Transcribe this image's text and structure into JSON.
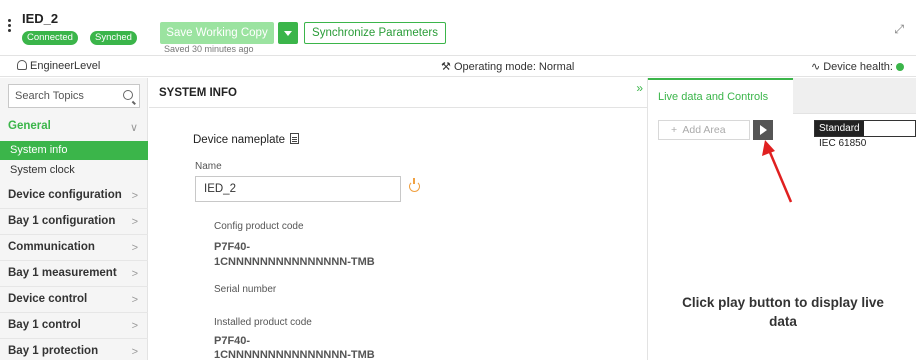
{
  "header": {
    "device_name": "IED_2",
    "badge_connected": "Connected",
    "badge_synched": "Synched",
    "save_label": "Save Working Copy",
    "sync_label": "Synchronize Parameters",
    "saved_text": "Saved 30 minutes ago",
    "accent_color": "#3bb54a"
  },
  "subbar": {
    "user": "EngineerLevel",
    "operating_mode": "Operating mode: Normal",
    "device_health": "Device health:"
  },
  "sidebar": {
    "search_placeholder": "Search Topics",
    "general": "General",
    "sub_items": [
      "System info",
      "System clock"
    ],
    "items": [
      "Device configuration",
      "Bay 1 configuration",
      "Communication",
      "Bay 1 measurement",
      "Device control",
      "Bay 1 control",
      "Bay 1 protection"
    ]
  },
  "content": {
    "title": "SYSTEM INFO",
    "nameplate_title": "Device nameplate",
    "name_label": "Name",
    "name_value": "IED_2",
    "config_code_label": "Config product code",
    "config_code_line1": "P7F40-",
    "config_code_line2": "1CNNNNNNNNNNNNNNN-TMB",
    "serial_label": "Serial number",
    "installed_code_label": "Installed product code",
    "installed_code_line1": "P7F40-",
    "installed_code_line2": "1CNNNNNNNNNNNNNNN-TMB"
  },
  "right_panel": {
    "tab_label": "Live data and Controls",
    "add_area": "Add Area",
    "standard_key": "Standard",
    "standard_value": "IEC 61850",
    "hint_line1": "Click play button to display live",
    "hint_line2": "data"
  }
}
